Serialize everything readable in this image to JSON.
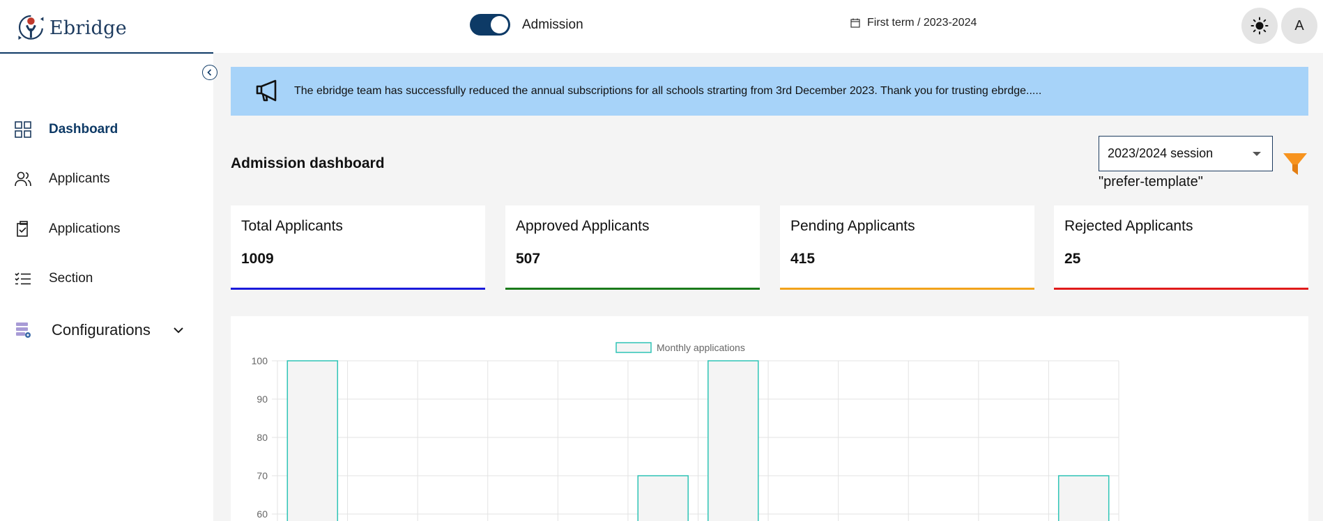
{
  "header": {
    "logo_text": "Ebridge",
    "admission_toggle_label": "Admission",
    "admission_toggle_on": true,
    "term_label": "First term / 2023-2024",
    "avatar_initial": "A"
  },
  "sidebar": {
    "items": [
      {
        "label": "Dashboard",
        "icon": "grid-icon",
        "active": true
      },
      {
        "label": "Applicants",
        "icon": "users-icon",
        "active": false
      },
      {
        "label": "Applications",
        "icon": "clipboard-check-icon",
        "active": false
      },
      {
        "label": "Section",
        "icon": "list-checks-icon",
        "active": false
      },
      {
        "label": "Configurations",
        "icon": "database-gear-icon",
        "active": false
      }
    ]
  },
  "banner": {
    "message": "The ebridge team has successfully reduced the annual subscriptions for all schools strarting from 3rd December 2023. Thank you for trusting ebrdge.....",
    "color": "#a7d3f9"
  },
  "main": {
    "title": "Admission dashboard",
    "session_select": {
      "value": "2023/2024 session"
    },
    "session_hint": "\"prefer-template\""
  },
  "cards": [
    {
      "title": "Total Applicants",
      "value": "1009",
      "color": "#1a1adb"
    },
    {
      "title": "Approved Applicants",
      "value": "507",
      "color": "#1a7a1a"
    },
    {
      "title": "Pending Applicants",
      "value": "415",
      "color": "#f2a21a"
    },
    {
      "title": "Rejected Applicants",
      "value": "25",
      "color": "#e01a1a"
    }
  ],
  "chart_data": {
    "type": "bar",
    "legend": [
      "Monthly applications"
    ],
    "series": [
      {
        "name": "Monthly applications",
        "values": [
          100,
          0,
          0,
          0,
          0,
          70,
          100,
          0,
          0,
          0,
          0,
          70
        ]
      }
    ],
    "y_ticks": [
      60,
      70,
      80,
      90,
      100
    ],
    "ylim_visible": [
      57,
      100
    ],
    "bar_stroke_color": "#2ec4b6",
    "bar_fill_color": "#f4f4f4",
    "grid": true,
    "legend_position": "top"
  }
}
